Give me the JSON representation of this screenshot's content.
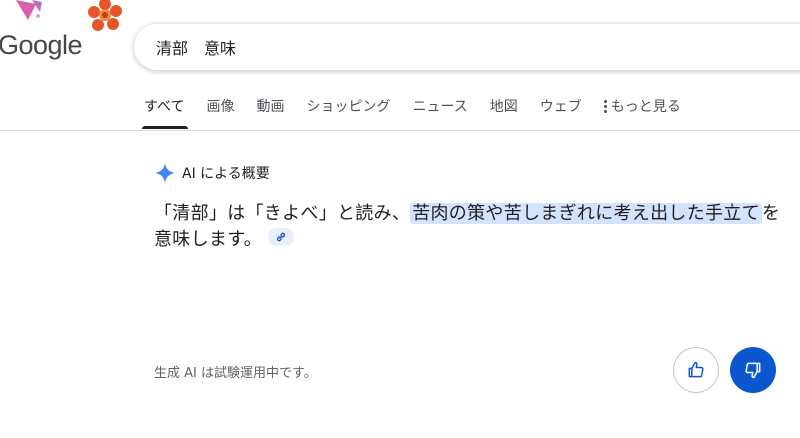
{
  "logo": {
    "text": "Google"
  },
  "search": {
    "query": "清部　意味"
  },
  "tabs": [
    {
      "label": "すべて",
      "active": true
    },
    {
      "label": "画像"
    },
    {
      "label": "動画"
    },
    {
      "label": "ショッピング"
    },
    {
      "label": "ニュース"
    },
    {
      "label": "地図"
    },
    {
      "label": "ウェブ"
    }
  ],
  "more_tab": {
    "label": "もっと見る",
    "icon": "more-vert-icon"
  },
  "ai_overview": {
    "title": "AI による概要",
    "icon": "sparkle-icon",
    "text_plain": "「清部」は「きよべ」と読み、",
    "text_highlight": "苦肉の策や苦しまぎれに考え出した手立て",
    "text_plain_2": "を意味します。",
    "link_icon": "link-icon",
    "disclaimer": "生成 AI は試験運用中です。"
  },
  "feedback": {
    "thumbs_up_icon": "thumbs-up-icon",
    "thumbs_down_icon": "thumbs-down-icon"
  },
  "colors": {
    "accent": "#0b57d0",
    "highlight": "#d3e3fd",
    "sparkle": "#4285f4"
  }
}
